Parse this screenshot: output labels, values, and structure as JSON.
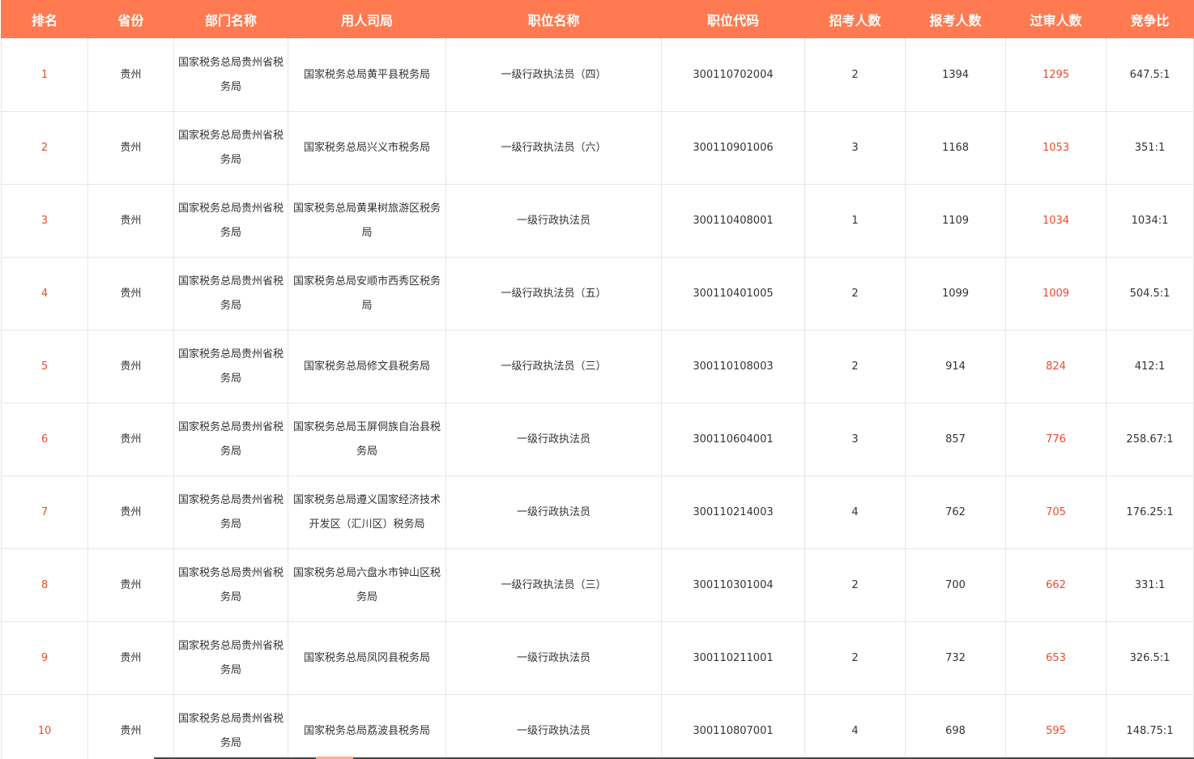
{
  "table": {
    "headers": [
      "排名",
      "省份",
      "部门名称",
      "用人司局",
      "职位名称",
      "职位代码",
      "招考人数",
      "报考人数",
      "过审人数",
      "竞争比"
    ],
    "rows": [
      {
        "rank": "1",
        "province": "贵州",
        "department": "国家税务总局贵州省税务局",
        "bureau": "国家税务总局黄平县税务局",
        "position": "一级行政执法员（四）",
        "code": "300110702004",
        "recruit": "2",
        "applicants": "1394",
        "approved": "1295",
        "ratio": "647.5:1"
      },
      {
        "rank": "2",
        "province": "贵州",
        "department": "国家税务总局贵州省税务局",
        "bureau": "国家税务总局兴义市税务局",
        "position": "一级行政执法员（六）",
        "code": "300110901006",
        "recruit": "3",
        "applicants": "1168",
        "approved": "1053",
        "ratio": "351:1"
      },
      {
        "rank": "3",
        "province": "贵州",
        "department": "国家税务总局贵州省税务局",
        "bureau": "国家税务总局黄果树旅游区税务局",
        "position": "一级行政执法员",
        "code": "300110408001",
        "recruit": "1",
        "applicants": "1109",
        "approved": "1034",
        "ratio": "1034:1"
      },
      {
        "rank": "4",
        "province": "贵州",
        "department": "国家税务总局贵州省税务局",
        "bureau": "国家税务总局安顺市西秀区税务局",
        "position": "一级行政执法员（五）",
        "code": "300110401005",
        "recruit": "2",
        "applicants": "1099",
        "approved": "1009",
        "ratio": "504.5:1"
      },
      {
        "rank": "5",
        "province": "贵州",
        "department": "国家税务总局贵州省税务局",
        "bureau": "国家税务总局修文县税务局",
        "position": "一级行政执法员（三）",
        "code": "300110108003",
        "recruit": "2",
        "applicants": "914",
        "approved": "824",
        "ratio": "412:1"
      },
      {
        "rank": "6",
        "province": "贵州",
        "department": "国家税务总局贵州省税务局",
        "bureau": "国家税务总局玉屏侗族自治县税务局",
        "position": "一级行政执法员",
        "code": "300110604001",
        "recruit": "3",
        "applicants": "857",
        "approved": "776",
        "ratio": "258.67:1"
      },
      {
        "rank": "7",
        "province": "贵州",
        "department": "国家税务总局贵州省税务局",
        "bureau": "国家税务总局遵义国家经济技术开发区（汇川区）税务局",
        "position": "一级行政执法员",
        "code": "300110214003",
        "recruit": "4",
        "applicants": "762",
        "approved": "705",
        "ratio": "176.25:1"
      },
      {
        "rank": "8",
        "province": "贵州",
        "department": "国家税务总局贵州省税务局",
        "bureau": "国家税务总局六盘水市钟山区税务局",
        "position": "一级行政执法员（三）",
        "code": "300110301004",
        "recruit": "2",
        "applicants": "700",
        "approved": "662",
        "ratio": "331:1"
      },
      {
        "rank": "9",
        "province": "贵州",
        "department": "国家税务总局贵州省税务局",
        "bureau": "国家税务总局凤冈县税务局",
        "position": "一级行政执法员",
        "code": "300110211001",
        "recruit": "2",
        "applicants": "732",
        "approved": "653",
        "ratio": "326.5:1"
      },
      {
        "rank": "10",
        "province": "贵州",
        "department": "国家税务总局贵州省税务局",
        "bureau": "国家税务总局荔波县税务局",
        "position": "一级行政执法员",
        "code": "300110807001",
        "recruit": "4",
        "applicants": "698",
        "approved": "595",
        "ratio": "148.75:1"
      }
    ]
  },
  "colors": {
    "header_bg": "#ff7a50",
    "header_text": "#ffffff",
    "highlight_red": "#ef4a2b",
    "cell_text": "#333333",
    "border": "#e6e6e6"
  }
}
